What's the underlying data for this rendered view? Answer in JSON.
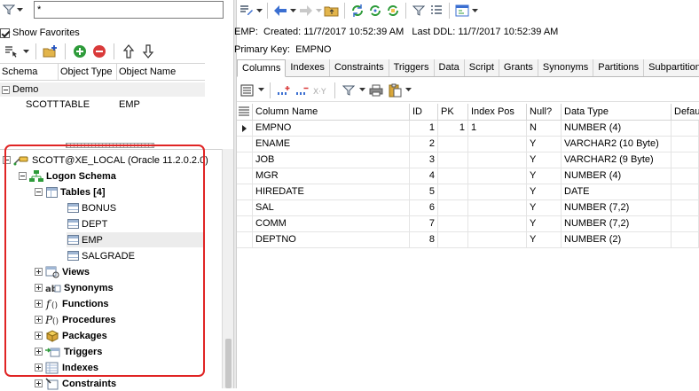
{
  "left": {
    "search": {
      "value": "*"
    },
    "show_favorites_label": "Show Favorites",
    "favorites": {
      "columns": [
        "Schema",
        "Object Type",
        "Object Name"
      ],
      "group": "Demo",
      "rows": [
        {
          "schema": "SCOTT",
          "type": "TABLE",
          "name": "EMP"
        }
      ]
    },
    "tree": {
      "connection": "SCOTT@XE_LOCAL (Oracle 11.2.0.2.0)",
      "schema": "Logon Schema",
      "tables_label": "Tables [4]",
      "tables": [
        "BONUS",
        "DEPT",
        "EMP",
        "SALGRADE"
      ],
      "categories": [
        "Views",
        "Synonyms",
        "Functions",
        "Procedures",
        "Packages",
        "Triggers",
        "Indexes",
        "Constraints"
      ]
    }
  },
  "right": {
    "info": {
      "object": "EMP:",
      "created_label": "Created:",
      "created": "11/7/2017 10:52:39 AM",
      "ddl_label": "Last DDL:",
      "ddl": "11/7/2017 10:52:39 AM",
      "pk_label": "Primary Key:",
      "pk": "EMPNO"
    },
    "tabs": [
      "Columns",
      "Indexes",
      "Constraints",
      "Triggers",
      "Data",
      "Script",
      "Grants",
      "Synonyms",
      "Partitions",
      "Subpartitions"
    ],
    "grid": {
      "headers": [
        "Column Name",
        "ID",
        "PK",
        "Index Pos",
        "Null?",
        "Data Type",
        "Default"
      ],
      "rows": [
        {
          "name": "EMPNO",
          "id": "1",
          "pk": "1",
          "idx": "1",
          "null": "N",
          "type": "NUMBER (4)"
        },
        {
          "name": "ENAME",
          "id": "2",
          "pk": "",
          "idx": "",
          "null": "Y",
          "type": "VARCHAR2 (10 Byte)"
        },
        {
          "name": "JOB",
          "id": "3",
          "pk": "",
          "idx": "",
          "null": "Y",
          "type": "VARCHAR2 (9 Byte)"
        },
        {
          "name": "MGR",
          "id": "4",
          "pk": "",
          "idx": "",
          "null": "Y",
          "type": "NUMBER (4)"
        },
        {
          "name": "HIREDATE",
          "id": "5",
          "pk": "",
          "idx": "",
          "null": "Y",
          "type": "DATE"
        },
        {
          "name": "SAL",
          "id": "6",
          "pk": "",
          "idx": "",
          "null": "Y",
          "type": "NUMBER (7,2)"
        },
        {
          "name": "COMM",
          "id": "7",
          "pk": "",
          "idx": "",
          "null": "Y",
          "type": "NUMBER (7,2)"
        },
        {
          "name": "DEPTNO",
          "id": "8",
          "pk": "",
          "idx": "",
          "null": "Y",
          "type": "NUMBER (2)"
        }
      ]
    }
  },
  "colors": {
    "highlight_box": "#e02424",
    "accent_green": "#2e9b3a",
    "accent_red": "#d93a3a",
    "folder": "#d9a73a"
  }
}
